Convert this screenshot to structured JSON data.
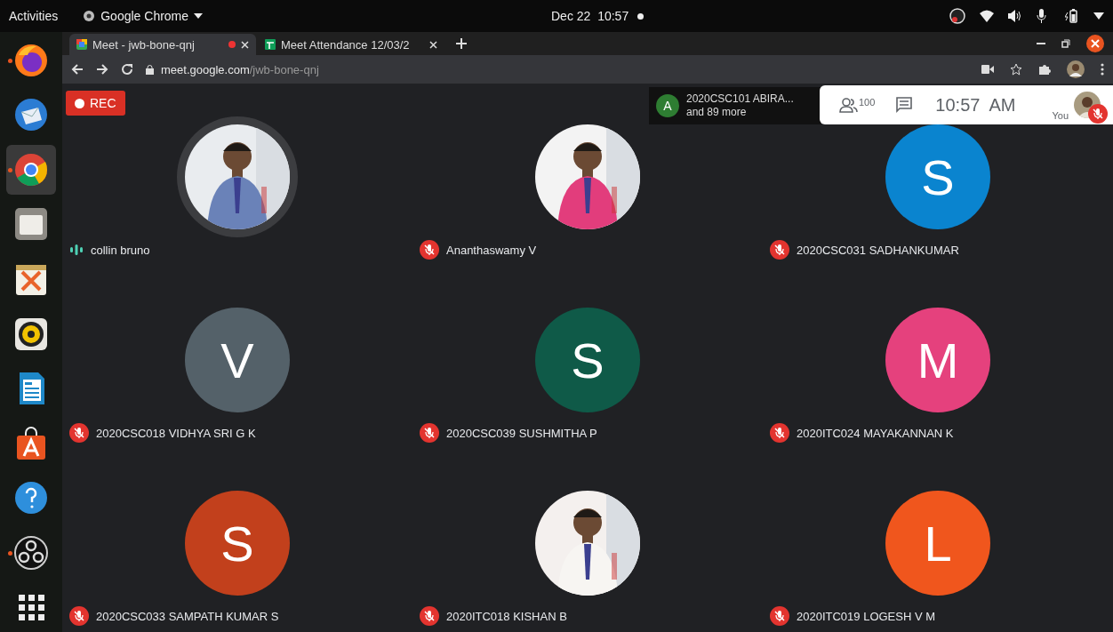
{
  "top_bar": {
    "activities": "Activities",
    "app_menu": "Google Chrome",
    "clock": "Dec 22  10:57"
  },
  "dock": [
    {
      "kind": "firefox",
      "running": true,
      "selected": false
    },
    {
      "kind": "mail",
      "running": false,
      "selected": false
    },
    {
      "kind": "chrome",
      "running": true,
      "selected": true
    },
    {
      "kind": "files",
      "running": false,
      "selected": false
    },
    {
      "kind": "notes",
      "running": false,
      "selected": false
    },
    {
      "kind": "speaker",
      "running": false,
      "selected": false
    },
    {
      "kind": "document",
      "running": false,
      "selected": false
    },
    {
      "kind": "store",
      "running": false,
      "selected": false
    },
    {
      "kind": "help",
      "running": false,
      "selected": false
    },
    {
      "kind": "obs",
      "running": true,
      "selected": false
    },
    {
      "kind": "apps",
      "running": false,
      "selected": false
    }
  ],
  "browser": {
    "tabs": [
      {
        "title": "Meet - jwb-bone-qnj",
        "kind": "meet",
        "recording": true,
        "selected": true
      },
      {
        "title": "Meet Attendance 12/03/2",
        "kind": "sheets",
        "recording": false,
        "selected": false
      }
    ],
    "url": {
      "host": "meet.google.com",
      "path": "/jwb-bone-qnj"
    }
  },
  "meet": {
    "rec_label": "REC",
    "join_notice": {
      "letter": "A",
      "name": "2020CSC101 ABIRA...",
      "more": "and 89 more"
    },
    "participants_count": "100",
    "time": "10:57  AM",
    "self_label": "You",
    "tiles": [
      {
        "name": "collin bruno",
        "muted": false,
        "speaking": true
      },
      {
        "name": "Ananthaswamy V",
        "muted": true,
        "speaking": false
      },
      {
        "name": "2020CSC031 SADHANKUMAR",
        "kind": "letter",
        "letter": "S",
        "color": "#0a84cf",
        "muted": true,
        "speaking": false
      },
      {
        "name": "2020CSC018 VIDHYA SRI G K",
        "kind": "letter",
        "letter": "V",
        "color": "#546169",
        "muted": true,
        "speaking": false
      },
      {
        "name": "2020CSC039 SUSHMITHA P",
        "kind": "letter",
        "letter": "S",
        "color": "#0f5a48",
        "muted": true,
        "speaking": false
      },
      {
        "name": "2020ITC024 MAYAKANNAN K",
        "kind": "letter",
        "letter": "M",
        "color": "#e5417d",
        "muted": true,
        "speaking": false
      },
      {
        "name": "2020CSC033 SAMPATH KUMAR S",
        "kind": "letter",
        "letter": "S",
        "color": "#c2401c",
        "muted": true,
        "speaking": false
      },
      {
        "name": "2020ITC018 KISHAN B",
        "muted": true,
        "speaking": false
      },
      {
        "name": "2020ITC019 LOGESH V M",
        "kind": "letter",
        "letter": "L",
        "color": "#f0561d",
        "muted": true,
        "speaking": false
      }
    ]
  }
}
